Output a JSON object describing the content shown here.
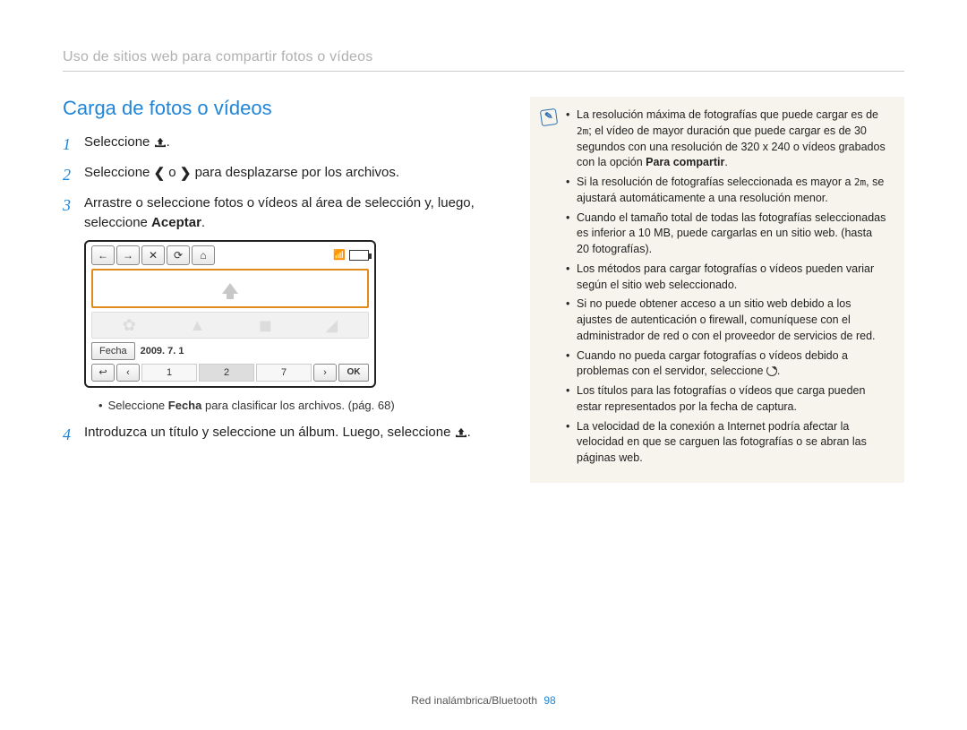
{
  "breadcrumb": "Uso de sitios web para compartir fotos o vídeos",
  "section_title": "Carga de fotos o vídeos",
  "steps": {
    "s1_pre": "Seleccione ",
    "s1_post": ".",
    "s2_pre": "Seleccione ",
    "s2_mid": " o ",
    "s2_post": " para desplazarse por los archivos.",
    "s3_a": "Arrastre o seleccione fotos o vídeos al área de selección y, luego, seleccione ",
    "s3_bold": "Aceptar",
    "s3_b": ".",
    "s4_a": "Introduzca un título y seleccione un álbum. Luego, seleccione ",
    "s4_b": "."
  },
  "mock": {
    "fecha_label": "Fecha",
    "date": "2009. 7. 1",
    "pages": [
      "1",
      "2",
      "7"
    ],
    "ok": "OK"
  },
  "subbullet_pre": "Seleccione ",
  "subbullet_bold": "Fecha",
  "subbullet_post": " para clasificar los archivos. (pág. 68)",
  "notes": {
    "n1_a": "La resolución máxima de fotografías que puede cargar es de ",
    "n1_icon": "2m",
    "n1_b": "; el vídeo de mayor duración que puede cargar es de 30 segundos con una resolución de 320 x 240 o vídeos grabados con la opción ",
    "n1_bold": "Para compartir",
    "n1_c": ".",
    "n2_a": "Si la resolución de fotografías seleccionada es mayor a ",
    "n2_icon": "2m",
    "n2_b": ", se ajustará automáticamente a una resolución menor.",
    "n3": "Cuando el tamaño total de todas las fotografías seleccionadas es inferior a 10 MB, puede cargarlas en un sitio web. (hasta 20 fotografías).",
    "n4": "Los métodos para cargar fotografías o vídeos pueden variar según el sitio web seleccionado.",
    "n5": "Si no puede obtener acceso a un sitio web debido a los ajustes de autenticación o firewall, comuníquese con el administrador de red o con el proveedor de servicios de red.",
    "n6_a": "Cuando no pueda cargar fotografías o vídeos debido a problemas con el servidor, seleccione ",
    "n6_b": ".",
    "n7": "Los títulos para las fotografías o vídeos que carga pueden estar representados por la fecha de captura.",
    "n8": "La velocidad de la conexión a Internet podría afectar la velocidad en que se carguen las fotografías o se abran las páginas web."
  },
  "footer_section": "Red inalámbrica/Bluetooth",
  "footer_page": "98"
}
